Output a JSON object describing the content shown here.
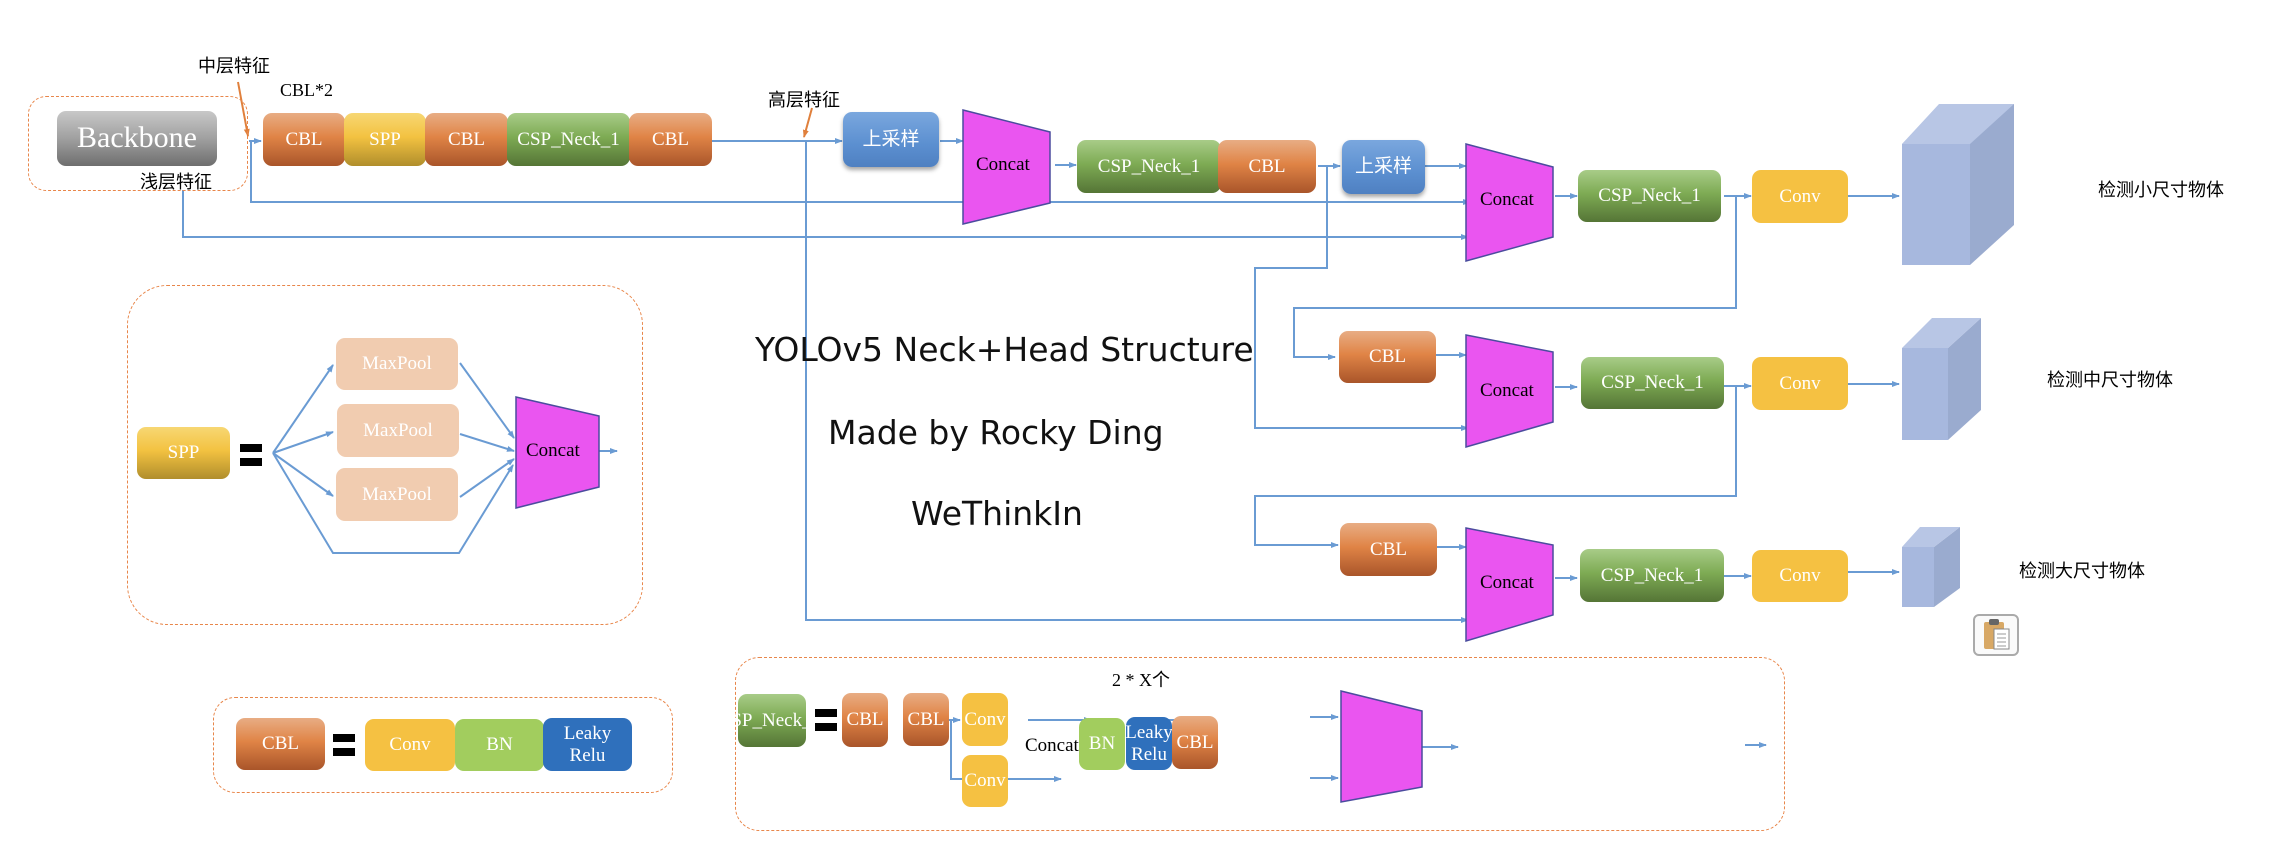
{
  "title": {
    "line1": "YOLOv5 Neck+Head Structure",
    "line2": "Made by Rocky Ding",
    "line3": "WeThinkIn"
  },
  "annotations": {
    "mid_feature": "中层特征",
    "shallow_feature": "浅层特征",
    "high_feature": "高层特征",
    "cbl_x2": "CBL*2",
    "two_x": "2 * X个"
  },
  "backbone": {
    "label": "Backbone"
  },
  "top_row": [
    "CBL",
    "SPP",
    "CBL",
    "CSP_Neck_1",
    "CBL"
  ],
  "neck": {
    "upsample1": "上采样",
    "concat1": "Concat",
    "csp1": "CSP_Neck_1",
    "cbl1": "CBL",
    "upsample2": "上采样",
    "concat2": "Concat",
    "csp2": "CSP_Neck_1",
    "conv_small": "Conv",
    "cbl_mid": "CBL",
    "concat_mid": "Concat",
    "csp_mid": "CSP_Neck_1",
    "conv_mid": "Conv",
    "cbl_large": "CBL",
    "concat_large": "Concat",
    "csp_large": "CSP_Neck_1",
    "conv_large": "Conv"
  },
  "outputs": {
    "small": "检测小尺寸物体",
    "medium": "检测中尺寸物体",
    "large": "检测大尺寸物体"
  },
  "spp_legend": {
    "spp": "SPP",
    "maxpools": [
      "MaxPool",
      "MaxPool",
      "MaxPool"
    ],
    "concat": "Concat"
  },
  "cbl_legend": {
    "cbl": "CBL",
    "parts": [
      "Conv",
      "BN",
      "Leaky Relu"
    ]
  },
  "csp_legend": {
    "csp": "CSP_Neck_X",
    "cbl1": "CBL",
    "cbl2": "CBL",
    "conv1": "Conv",
    "conv2": "Conv",
    "concat": "Concat",
    "bn": "BN",
    "relu": "Leaky Relu",
    "cbl_out": "CBL"
  },
  "colors": {
    "cbl": "#e08446",
    "spp": "#f3c241",
    "csp": "#7eab54",
    "upsample": "#5b8fd0",
    "concat": "#ea55f0",
    "conv": "#f5c142",
    "bn": "#a2cd5e",
    "leaky_relu": "#2f70bc",
    "maxpool": "#f1ccb0",
    "wire": "#6a9bd3",
    "annotation_arrow": "#e0803c",
    "cube": "#a7b8de"
  }
}
